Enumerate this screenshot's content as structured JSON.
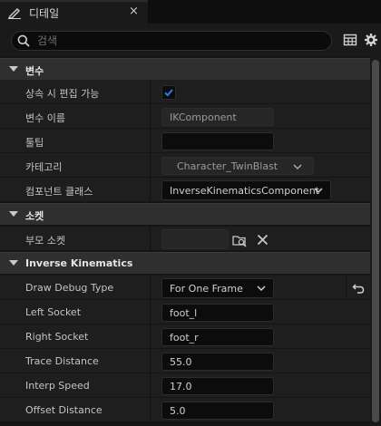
{
  "tab": {
    "title": "디테일",
    "icon": "pencil-icon",
    "close": "×"
  },
  "search": {
    "placeholder": "검색",
    "value": ""
  },
  "toolbar": {
    "table_icon": "table-icon",
    "settings_icon": "gear-icon"
  },
  "colors": {
    "accent": "#2f7fe6",
    "panel_bg": "#151515",
    "category_bg": "#2f2f2f",
    "row_bg": "#1e1e1e"
  },
  "categories": {
    "variables": {
      "label": "변수",
      "rows": {
        "editable_on_instance": {
          "label": "상속 시 편집 가능",
          "checked": true
        },
        "variable_name": {
          "label": "변수 이름",
          "value": "IKComponent"
        },
        "tooltip": {
          "label": "툴팁",
          "value": ""
        },
        "category": {
          "label": "카테고리",
          "value": "Character_TwinBlast"
        },
        "component_class": {
          "label": "컴포넌트 클래스",
          "value": "InverseKinematicsComponent"
        }
      }
    },
    "socket": {
      "label": "소켓",
      "rows": {
        "parent_socket": {
          "label": "부모 소켓",
          "value": ""
        }
      }
    },
    "ik": {
      "label": "Inverse Kinematics",
      "rows": {
        "draw_debug_type": {
          "label": "Draw Debug Type",
          "value": "For One Frame"
        },
        "left_socket": {
          "label": "Left Socket",
          "value": "foot_l"
        },
        "right_socket": {
          "label": "Right Socket",
          "value": "foot_r"
        },
        "trace_distance": {
          "label": "Trace Distance",
          "value": "55.0"
        },
        "interp_speed": {
          "label": "Interp Speed",
          "value": "17.0"
        },
        "offset_distance": {
          "label": "Offset Distance",
          "value": "5.0"
        }
      }
    }
  }
}
